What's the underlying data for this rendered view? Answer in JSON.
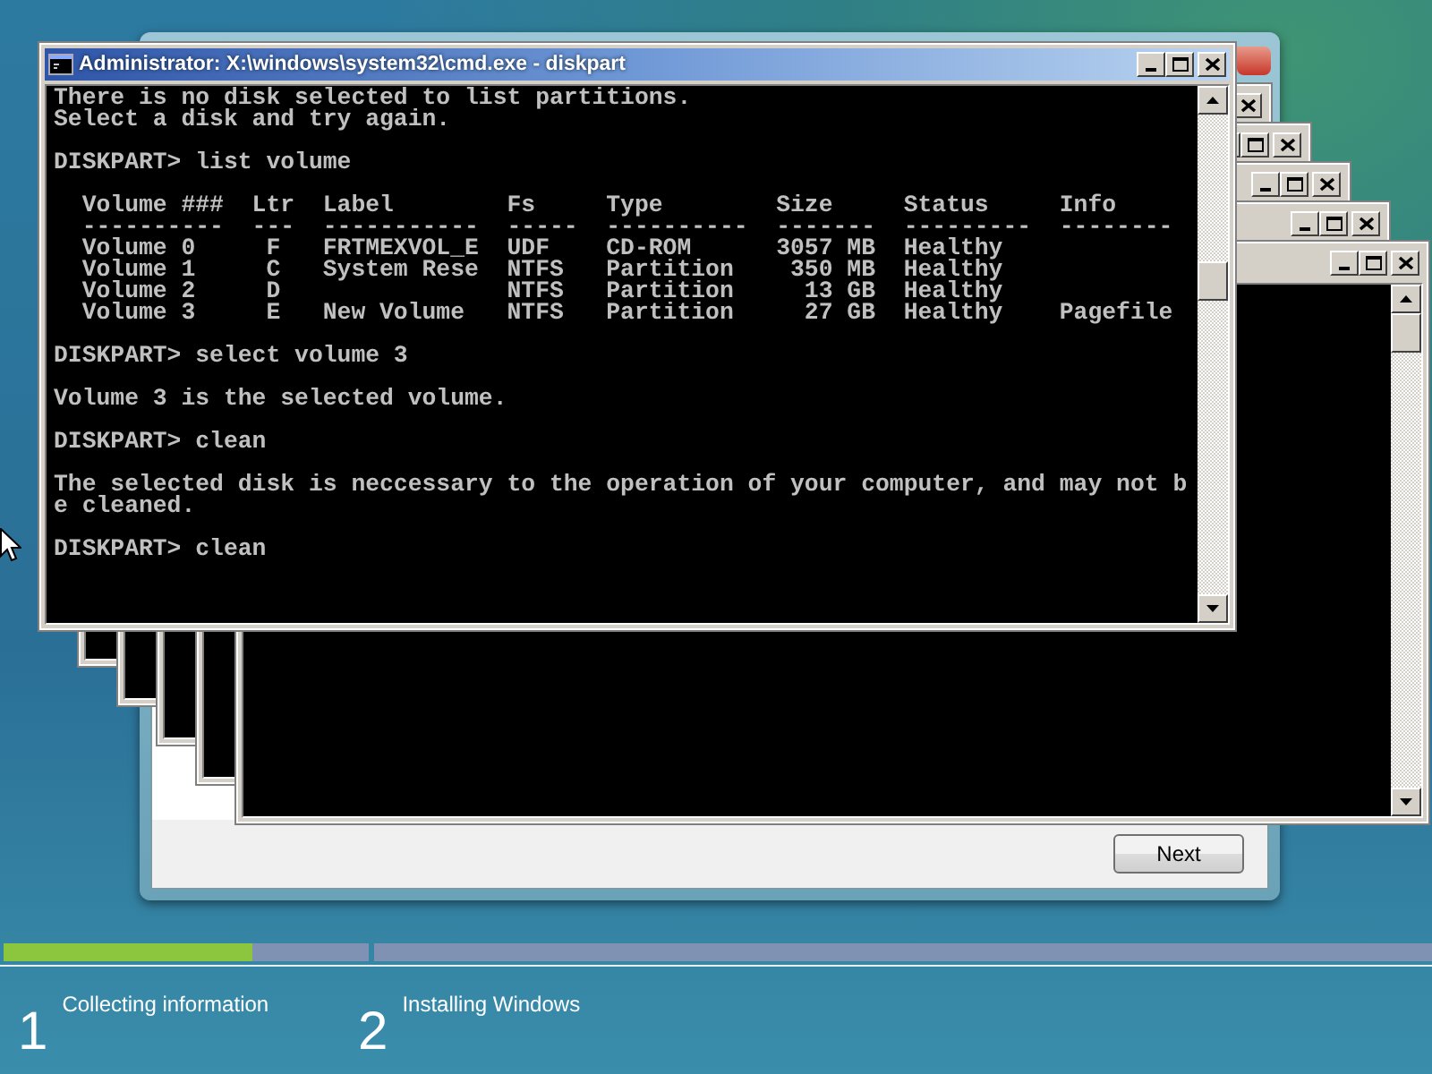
{
  "setup_dialog": {
    "next_button": "Next"
  },
  "background_consoles": [
    {
      "active": false
    },
    {
      "active": false
    },
    {
      "active": false
    },
    {
      "active": false
    },
    {
      "active": false
    }
  ],
  "console_window": {
    "title": "Administrator: X:\\windows\\system32\\cmd.exe - diskpart",
    "active": true,
    "blocks": [
      [
        "There is no disk selected to list partitions.",
        "Select a disk and try again."
      ],
      [
        "DISKPART> list volume"
      ],
      [
        "  Volume ###  Ltr  Label        Fs     Type        Size     Status     Info",
        "  ----------  ---  -----------  -----  ----------  -------  ---------  --------",
        "  Volume 0     F   FRTMEXVOL_E  UDF    CD-ROM      3057 MB  Healthy",
        "  Volume 1     C   System Rese  NTFS   Partition    350 MB  Healthy",
        "  Volume 2     D                NTFS   Partition     13 GB  Healthy",
        "  Volume 3     E   New Volume   NTFS   Partition     27 GB  Healthy    Pagefile"
      ],
      [
        "DISKPART> select volume 3"
      ],
      [
        "Volume 3 is the selected volume."
      ],
      [
        "DISKPART> clean"
      ],
      [
        "The selected disk is neccessary to the operation of your computer, and may not b",
        "e cleaned."
      ],
      [
        "DISKPART> clean"
      ]
    ]
  },
  "progress": {
    "steps": [
      {
        "number": "1",
        "label": "Collecting information",
        "level": 0.68
      },
      {
        "number": "2",
        "label": "Installing Windows",
        "level": 0
      }
    ]
  }
}
